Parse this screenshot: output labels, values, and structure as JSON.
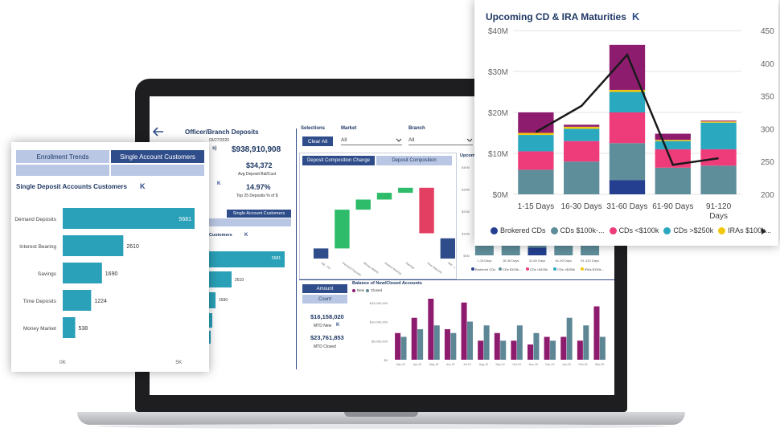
{
  "colors": {
    "navy": "#2f4d8a",
    "teal": "#2aa1b8",
    "purple": "#8e1c6e",
    "slate": "#5e8795",
    "brokered": "#243f8f",
    "cds_100k_plus": "#5f8e9b",
    "cds_under_100k": "#ee3c7b",
    "cds_250k": "#2aa8c0",
    "iras": "#f2c80f",
    "line": "#1a1a1a",
    "green": "#2ebc6a",
    "red": "#e23f62"
  },
  "dashboard": {
    "back_icon": "arrow-left-icon",
    "title": "Officer/Branch Deposits",
    "date": "03/27/2020",
    "deposits_total": "$938,910,908",
    "deposits_label_suffix": "s)",
    "avg_deposit_value": "$34,372",
    "avg_deposit_label": "Avg Deposit Bal/Cust",
    "top25_value": "14.97%",
    "top25_label": "Top 25 Deposits % of $",
    "small_k_mark": "K",
    "selections_label": "Selections",
    "clear_all": "Clear All",
    "market_label": "Market",
    "market_value": "All",
    "branch_label": "Branch",
    "branch_value": "All",
    "tab_comp_change": "Deposit Composition Change",
    "tab_comp": "Deposit Composition",
    "upcoming_label": "Upcoming",
    "amount_btn": "Amount",
    "count_btn": "Count",
    "mtd_new_value": "$16,158,020",
    "mtd_new_label": "MTD New",
    "mtd_closed_value": "$23,761,853",
    "mtd_closed_label": "MTD Closed",
    "balance_title": "Balance of New/Closed Accounts",
    "legend_new": "New",
    "legend_closed": "Closed",
    "single_tab": "Single Account Customers",
    "customers_label": "Customers",
    "bar_5681": "5681",
    "bar_2610": "2610",
    "bar_1690": "1690",
    "waterfall_labels": [
      "Adj - CD",
      "Demand Deposits",
      "Money Market",
      "Interest Bearing",
      "Savings",
      "Time Deposits",
      "Mar - 20"
    ],
    "waterfall_yticks": [
      "$100M",
      "$80M",
      "$60M",
      "$40M",
      "$20M",
      "$0M"
    ],
    "balance_months": [
      "Mar-19",
      "Apr-19",
      "May-19",
      "Jun-19",
      "Jul-19",
      "Aug-19",
      "Sep-19",
      "Oct-19",
      "Nov-19",
      "Dec-19",
      "Jan-20",
      "Feb-20",
      "Mar-20"
    ],
    "balance_yticks": [
      "$15,000,000",
      "$10,000,000",
      "$5,000,000",
      "$0"
    ],
    "mini_maturity_xlabels": [
      "1-15 Days",
      "16-30 Days",
      "31-60 Days",
      "61-90 Days",
      "91-120 Days"
    ],
    "mini_maturity_yticks": [
      "$40M",
      "$30M",
      "$20M",
      "$10M",
      "$0M"
    ],
    "mini_maturity_legend": [
      "Brokered CDs",
      "CDs $100k-...",
      "CDs <$100k",
      "CDs >$250k",
      "IRAs $100k..."
    ]
  },
  "left_card": {
    "tab1": "Enrollment Trends",
    "tab2": "Single Account Customers",
    "title": "Single Deposit Accounts Customers",
    "k_mark": "K",
    "axis_start": "0K",
    "axis_end": "5K",
    "bars": [
      {
        "label": "Demand Deposits",
        "value": 5681
      },
      {
        "label": "Interest Bearing",
        "value": 2610
      },
      {
        "label": "Savings",
        "value": 1690
      },
      {
        "label": "Time Deposits",
        "value": 1224
      },
      {
        "label": "Money Market",
        "value": 538
      }
    ],
    "value_labels": [
      "5681",
      "2610",
      "1690",
      "1224",
      "538"
    ]
  },
  "chart_data": {
    "type": "bar",
    "title": "Upcoming CD & IRA  Maturities",
    "categories": [
      "1-15 Days",
      "16-30 Days",
      "31-60 Days",
      "61-90 Days",
      "91-120 Days"
    ],
    "category_lines": [
      [
        "1-15 Days"
      ],
      [
        "16-30 Days"
      ],
      [
        "31-60 Days"
      ],
      [
        "61-90 Days"
      ],
      [
        "91-120",
        "Days"
      ]
    ],
    "ylim": [
      0,
      40
    ],
    "yticks": [
      "$0M",
      "$10M",
      "$20M",
      "$30M",
      "$40M"
    ],
    "ytick_values": [
      0,
      10,
      20,
      30,
      40
    ],
    "y2lim": [
      200,
      450
    ],
    "y2ticks": [
      "200",
      "250",
      "300",
      "350",
      "400",
      "450"
    ],
    "y2tick_values": [
      200,
      250,
      300,
      350,
      400,
      450
    ],
    "series": [
      {
        "name": "Brokered CDs",
        "color": "#243f8f",
        "values": [
          0,
          0,
          3.5,
          0,
          0
        ]
      },
      {
        "name": "CDs $100k-...",
        "color": "#5f8e9b",
        "values": [
          6,
          8,
          9,
          6.5,
          7
        ]
      },
      {
        "name": "CDs <$100k",
        "color": "#ee3c7b",
        "values": [
          4.5,
          5,
          7.5,
          4.5,
          4
        ]
      },
      {
        "name": "CDs >$250k",
        "color": "#2aa8c0",
        "values": [
          4,
          3,
          5,
          2,
          6.5
        ]
      },
      {
        "name": "IRAs $100k...",
        "color": "#f2c80f",
        "values": [
          0.5,
          0.5,
          0.5,
          0.3,
          0.3
        ]
      },
      {
        "name": "",
        "color": "#8e1c6e",
        "values": [
          5,
          0.5,
          11,
          1.5,
          0.2
        ]
      }
    ],
    "line_series": {
      "axis": "right",
      "values": [
        295,
        335,
        413,
        245,
        255
      ]
    },
    "legend": [
      "Brokered CDs",
      "CDs $100k-...",
      "CDs <$100k",
      "CDs >$250k",
      "IRAs $100k..."
    ],
    "legend_more_icon": "play-right-icon",
    "title_icon_text": "K"
  }
}
